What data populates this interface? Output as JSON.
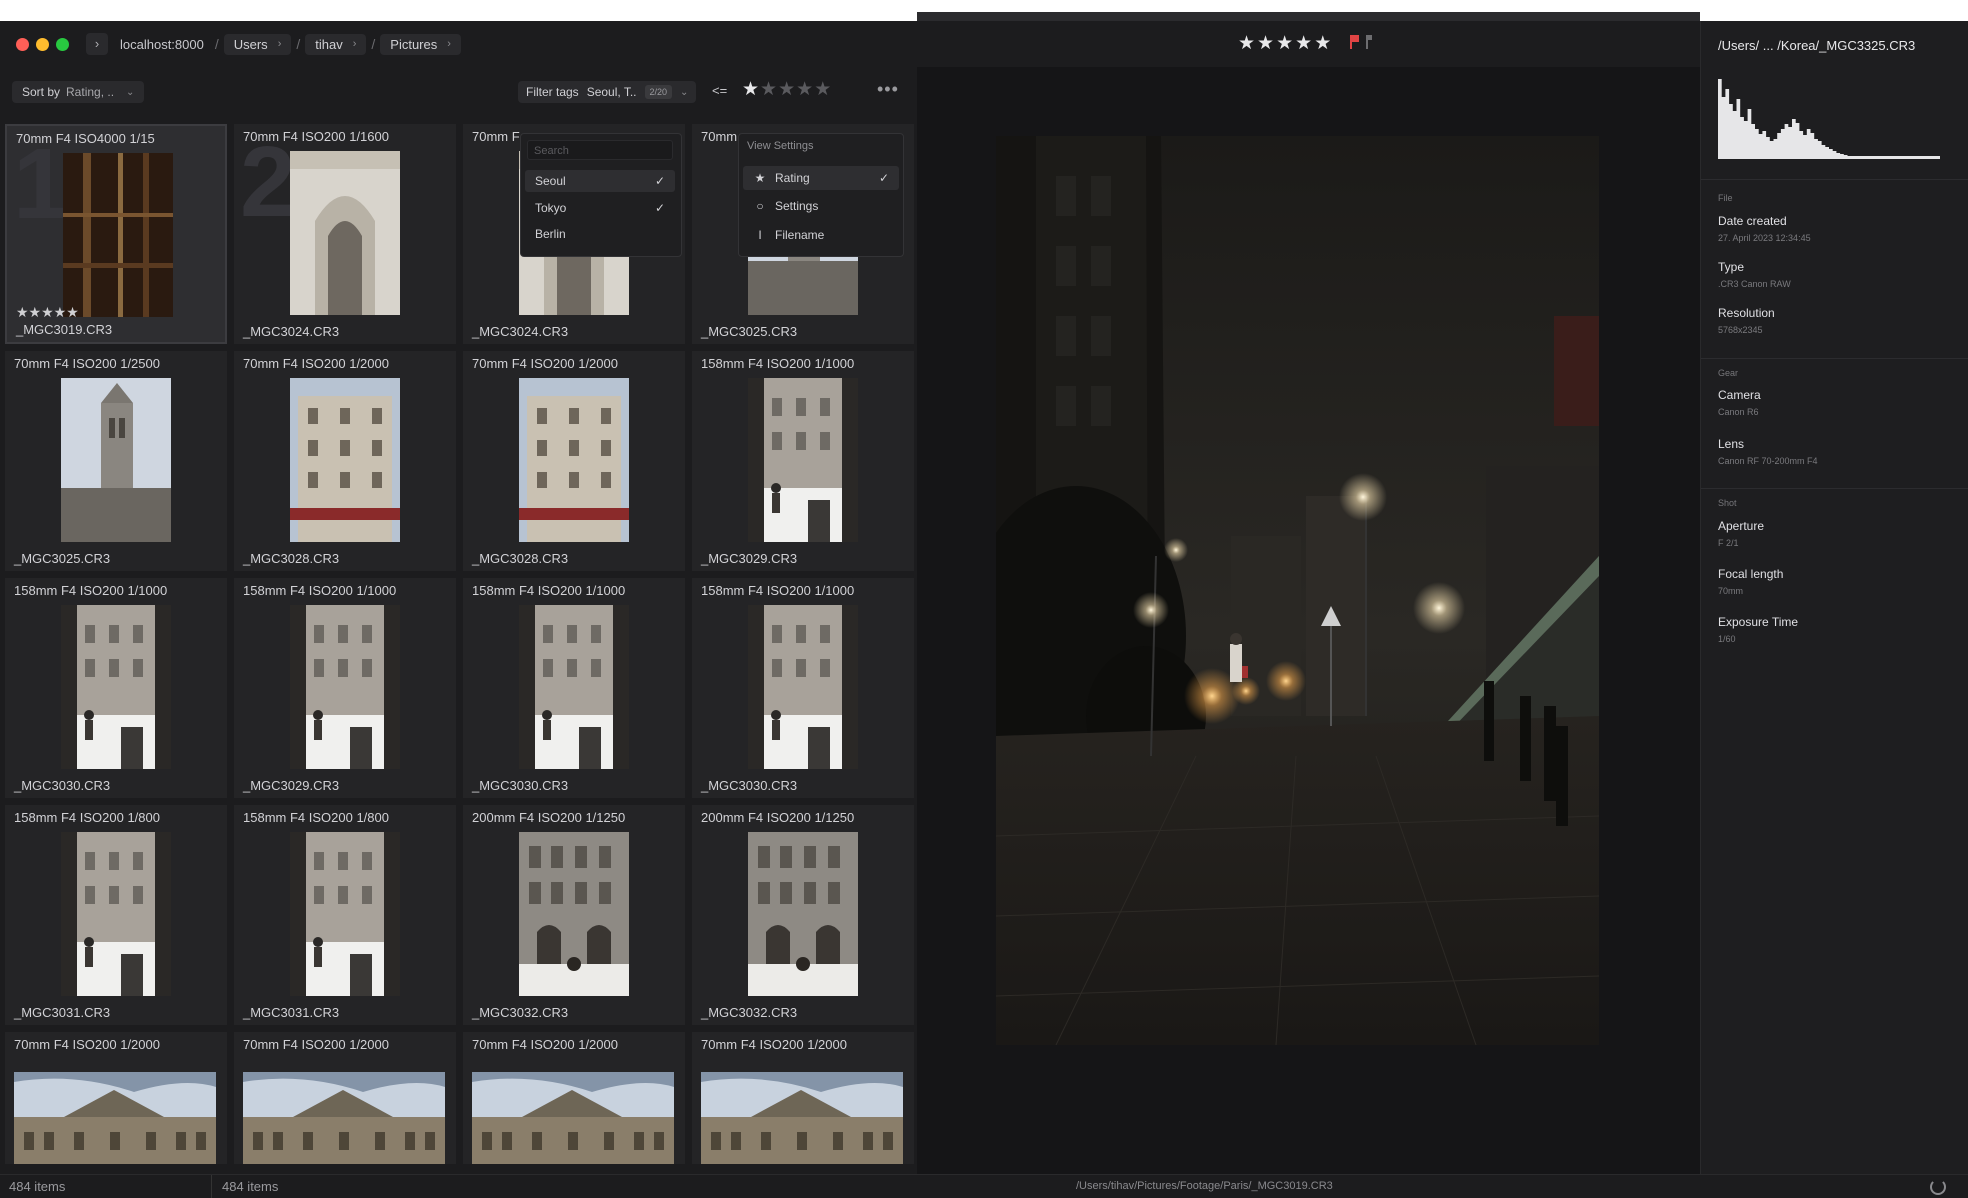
{
  "breadcrumb": {
    "host": "localhost:8000",
    "items": [
      "Users",
      "tihav",
      "Pictures"
    ]
  },
  "viewer": {
    "rating": 5,
    "flag": "red"
  },
  "toolbar": {
    "sort_label": "Sort by",
    "sort_value": "Rating, ..",
    "filter_label": "Filter tags",
    "filter_value": "Seoul, T..",
    "filter_count": "2/20",
    "compare_op": "<=",
    "rating_filter": 1
  },
  "tag_dropdown": {
    "search_placeholder": "Search",
    "options": [
      {
        "label": "Seoul",
        "checked": "✓"
      },
      {
        "label": "Tokyo",
        "checked": "✓"
      },
      {
        "label": "Berlin",
        "checked": ""
      }
    ]
  },
  "view_dropdown": {
    "header": "View Settings",
    "options": [
      {
        "label": "Rating",
        "icon": "star-icon",
        "checked": "✓"
      },
      {
        "label": "Settings",
        "icon": "circle-icon",
        "checked": ""
      },
      {
        "label": "Filename",
        "icon": "text-cursor-icon",
        "checked": ""
      }
    ]
  },
  "grid": {
    "cells": [
      {
        "meta": "70mm F4 ISO4000 1/15",
        "name": "_MGC3019.CR3",
        "num": "1",
        "stars": "★★★★★",
        "thumb": "dark"
      },
      {
        "meta": "70mm F4 ISO200 1/1600",
        "name": "_MGC3024.CR3",
        "num": "2",
        "stars": "",
        "thumb": "arch"
      },
      {
        "meta": "70mm F",
        "name": "_MGC3024.CR3",
        "num": "",
        "stars": "",
        "thumb": "arch"
      },
      {
        "meta": "70mm",
        "name": "_MGC3025.CR3",
        "num": "",
        "stars": "",
        "thumb": "tower"
      },
      {
        "meta": "70mm F4 ISO200 1/2500",
        "name": "_MGC3025.CR3",
        "num": "",
        "stars": "",
        "thumb": "tower"
      },
      {
        "meta": "70mm F4 ISO200 1/2000",
        "name": "_MGC3028.CR3",
        "num": "",
        "stars": "",
        "thumb": "building"
      },
      {
        "meta": "70mm F4 ISO200 1/2000",
        "name": "_MGC3028.CR3",
        "num": "",
        "stars": "",
        "thumb": "building"
      },
      {
        "meta": "158mm F4 ISO200 1/1000",
        "name": "_MGC3029.CR3",
        "num": "",
        "stars": "",
        "thumb": "courtyard"
      },
      {
        "meta": "158mm F4 ISO200 1/1000",
        "name": "_MGC3030.CR3",
        "num": "",
        "stars": "",
        "thumb": "courtyard"
      },
      {
        "meta": "158mm F4 ISO200 1/1000",
        "name": "_MGC3029.CR3",
        "num": "",
        "stars": "",
        "thumb": "courtyard"
      },
      {
        "meta": "158mm F4 ISO200 1/1000",
        "name": "_MGC3030.CR3",
        "num": "",
        "stars": "",
        "thumb": "courtyard"
      },
      {
        "meta": "158mm F4 ISO200 1/1000",
        "name": "_MGC3030.CR3",
        "num": "",
        "stars": "",
        "thumb": "courtyard"
      },
      {
        "meta": "158mm F4 ISO200 1/800",
        "name": "_MGC3031.CR3",
        "num": "",
        "stars": "",
        "thumb": "courtyard"
      },
      {
        "meta": "158mm F4 ISO200 1/800",
        "name": "_MGC3031.CR3",
        "num": "",
        "stars": "",
        "thumb": "courtyard"
      },
      {
        "meta": "200mm F4 ISO200 1/1250",
        "name": "_MGC3032.CR3",
        "num": "",
        "stars": "",
        "thumb": "facade"
      },
      {
        "meta": "200mm F4 ISO200 1/1250",
        "name": "_MGC3032.CR3",
        "num": "",
        "stars": "",
        "thumb": "facade"
      },
      {
        "meta": "70mm F4 ISO200 1/2000",
        "name": "",
        "num": "",
        "stars": "",
        "thumb": "louvre"
      },
      {
        "meta": "70mm F4 ISO200 1/2000",
        "name": "",
        "num": "",
        "stars": "",
        "thumb": "louvre"
      },
      {
        "meta": "70mm F4 ISO200 1/2000",
        "name": "",
        "num": "",
        "stars": "",
        "thumb": "louvre"
      },
      {
        "meta": "70mm F4 ISO200 1/2000",
        "name": "",
        "num": "",
        "stars": "",
        "thumb": "louvre"
      }
    ]
  },
  "status": {
    "left_count": "484 items",
    "mid_count": "484 items",
    "path": "/Users/tihav/Pictures/Footage/Paris/_MGC3019.CR3"
  },
  "inspector": {
    "path": "/Users/ ... /Korea/_MGC3325.CR3",
    "file_section": "File",
    "date_label": "Date created",
    "date_value": "27. April 2023 12:34:45",
    "type_label": "Type",
    "type_value": ".CR3   Canon RAW",
    "res_label": "Resolution",
    "res_value": "5768x2345",
    "gear_section": "Gear",
    "camera_label": "Camera",
    "camera_value": "Canon R6",
    "lens_label": "Lens",
    "lens_value": "Canon RF 70-200mm F4",
    "shot_section": "Shot",
    "aperture_label": "Aperture",
    "aperture_value": "F 2/1",
    "focal_label": "Focal length",
    "focal_value": "70mm",
    "exposure_label": "Exposure Time",
    "exposure_value": "1/60",
    "histogram": [
      80,
      62,
      70,
      55,
      48,
      60,
      42,
      38,
      50,
      35,
      30,
      25,
      28,
      22,
      18,
      20,
      26,
      30,
      35,
      32,
      40,
      36,
      28,
      24,
      30,
      26,
      20,
      18,
      14,
      12,
      10,
      8,
      6,
      5,
      4,
      3,
      3,
      3,
      3,
      3,
      3,
      3,
      3,
      3,
      3,
      3,
      3,
      3,
      3,
      3,
      3,
      3,
      3,
      3,
      3,
      3,
      3,
      3,
      3,
      3
    ]
  },
  "colors": {
    "accent_flag": "#e04444",
    "bg": "#1c1c1e"
  }
}
